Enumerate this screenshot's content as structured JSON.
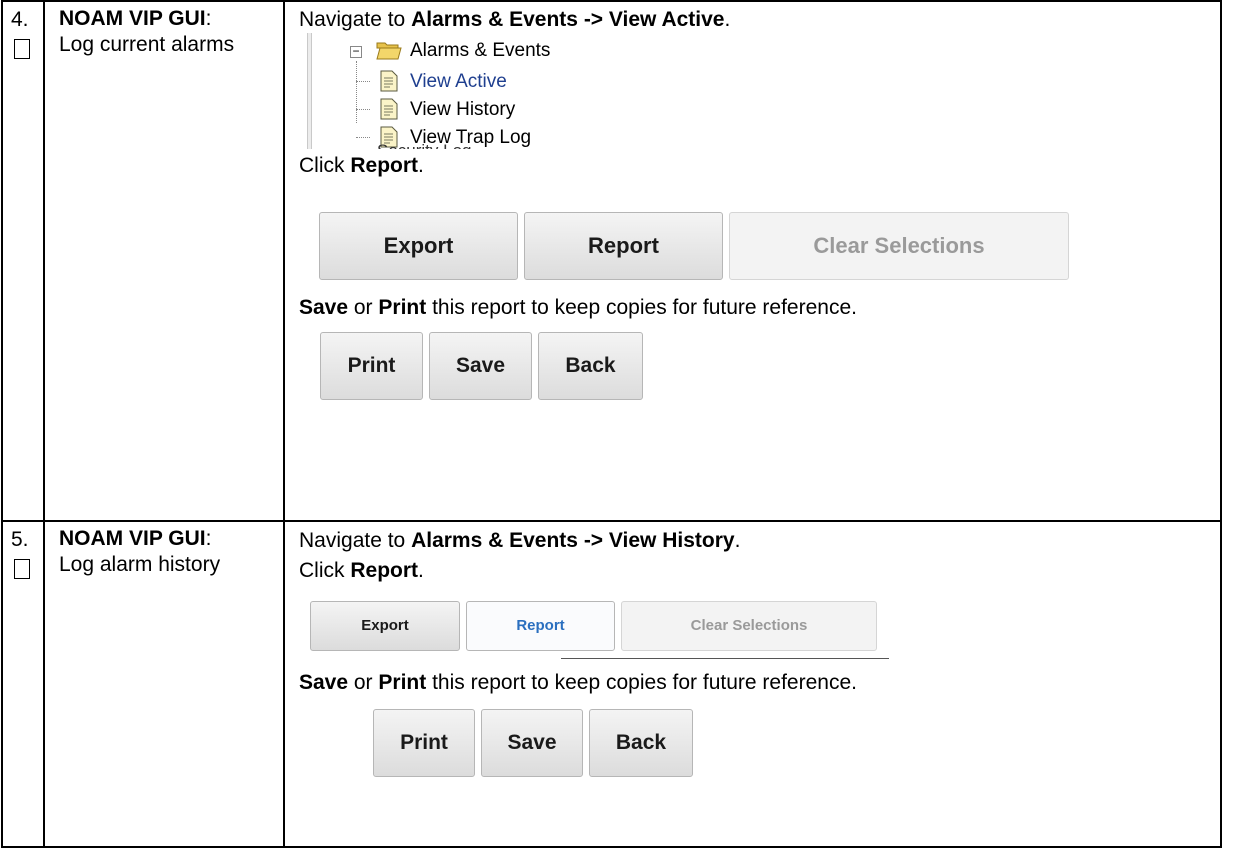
{
  "steps": [
    {
      "number": "4.",
      "title": "NOAM VIP GUI",
      "subtitle": "Log current alarms",
      "nav_prefix": "Navigate to ",
      "nav_path": "Alarms & Events -> View Active",
      "nav_suffix": ".",
      "tree": {
        "folder": "Alarms & Events",
        "items": [
          "View Active",
          "View History",
          "View Trap Log"
        ],
        "selected": "View Active",
        "cut_text": "Security Log"
      },
      "click_prefix": "Click ",
      "click_target": "Report",
      "click_suffix": ".",
      "report_buttons": [
        "Export",
        "Report",
        "Clear Selections"
      ],
      "save_text": {
        "save": "Save",
        "or": " or ",
        "print": "Print",
        "rest": " this report to keep copies for future reference."
      },
      "print_buttons": [
        "Print",
        "Save",
        "Back"
      ]
    },
    {
      "number": "5.",
      "title": "NOAM VIP GUI",
      "subtitle": "Log alarm history",
      "nav_prefix": "Navigate to ",
      "nav_path": "Alarms & Events -> View History",
      "nav_suffix": ".",
      "click_prefix": "Click ",
      "click_target": "Report",
      "click_suffix": ".",
      "report_buttons": [
        "Export",
        "Report",
        "Clear Selections"
      ],
      "save_text": {
        "save": "Save",
        "or": " or ",
        "print": "Print",
        "rest": " this report to keep copies for future reference."
      },
      "print_buttons": [
        "Print",
        "Save",
        "Back"
      ]
    }
  ],
  "colors": {
    "selected_link": "#1f3f8f",
    "active_button_text": "#2a6fbf",
    "disabled_text": "#9a9a9a"
  },
  "icons": [
    "checkbox",
    "tree-collapse-icon",
    "folder-open-icon",
    "page-icon"
  ]
}
